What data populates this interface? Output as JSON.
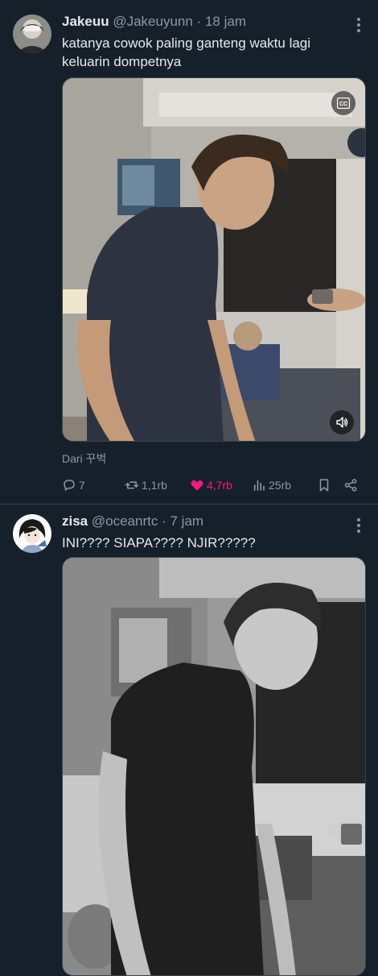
{
  "tweets": [
    {
      "name": "Jakeuu",
      "handle": "@Jakeuyunn",
      "separator": "·",
      "time": "18 jam",
      "text": "katanya cowok paling ganteng waktu lagi keluarin dompetnya",
      "from_label": "Dari 꾸벅",
      "stats": {
        "replies": "7",
        "reposts": "1,1rb",
        "likes": "4,7rb",
        "views": "25rb"
      },
      "media": {
        "type": "video",
        "has_captions_button": true,
        "has_volume_button": true
      }
    },
    {
      "name": "zisa",
      "handle": "@oceanrtc",
      "separator": "·",
      "time": "7 jam",
      "text": "INI???? SIAPA???? NJIR?????",
      "media": {
        "type": "image",
        "grayscale": true
      }
    }
  ],
  "colors": {
    "background": "#15202b",
    "secondary_text": "#8b98a5",
    "like_pink": "#f91880",
    "divider": "#38444d"
  },
  "icons": [
    "more-icon",
    "captions-icon",
    "volume-icon",
    "reply-icon",
    "repost-icon",
    "like-icon",
    "views-icon",
    "bookmark-icon",
    "share-icon"
  ]
}
